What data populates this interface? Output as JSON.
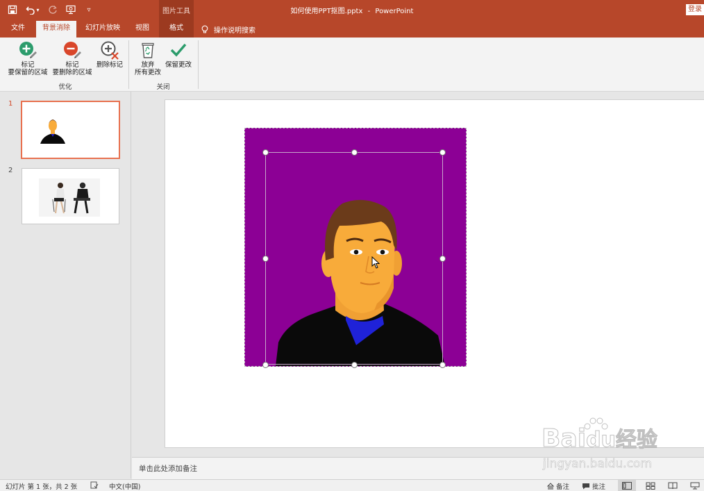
{
  "titlebar": {
    "context_tool": "图片工具",
    "file_name": "如何使用PPT抠图.pptx",
    "separator": "-",
    "app_name": "PowerPoint",
    "login_label": "登录",
    "qat": {
      "customize_glyph": "▿",
      "undo_dropdown_glyph": "▾"
    }
  },
  "tabs": {
    "file": "文件",
    "background_removal": "背景消除",
    "slideshow": "幻灯片放映",
    "view": "视图",
    "format": "格式",
    "tell_me": "操作说明搜索"
  },
  "ribbon": {
    "mark_keep_line1": "标记",
    "mark_keep_line2": "要保留的区域",
    "mark_remove_line1": "标记",
    "mark_remove_line2": "要删除的区域",
    "delete_mark": "删除标记",
    "refine_group": "优化",
    "discard_line1": "放弃",
    "discard_line2": "所有更改",
    "keep_changes": "保留更改",
    "close_group": "关闭"
  },
  "slides": [
    {
      "number": "1",
      "selected": true
    },
    {
      "number": "2",
      "selected": false
    }
  ],
  "notes": {
    "placeholder": "单击此处添加备注"
  },
  "status": {
    "slide_info": "幻灯片 第 1 张，共 2 张",
    "language": "中文(中国)",
    "notes_label": "备注",
    "comments_label": "批注"
  },
  "watermark": {
    "logo": "Bai",
    "logo_du": "du",
    "logo_cn": "经验",
    "url": "jingyan.baidu.com"
  },
  "colors": {
    "accent": "#b7472a",
    "context_tab": "#9c3a20",
    "image_background": "#8c0095",
    "skin": "#f8ab3a",
    "hair": "#6b3b1a",
    "shirt": "#0a0a0a",
    "collar": "#1f22d8",
    "keep_icon": "#2c9c6c",
    "remove_icon": "#d9462a"
  }
}
